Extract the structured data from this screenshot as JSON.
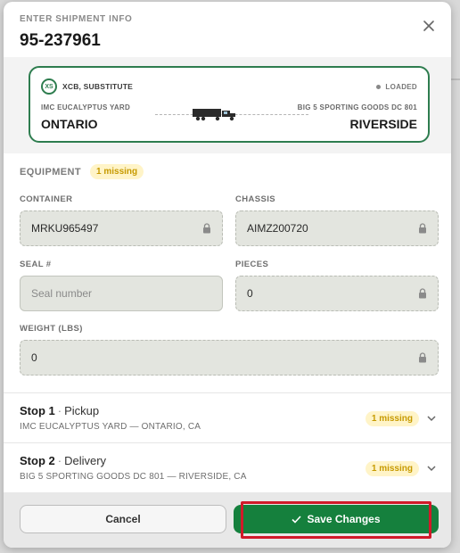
{
  "modal": {
    "eyebrow": "ENTER SHIPMENT INFO",
    "title": "95-237961"
  },
  "route": {
    "carrier_badge": "XS",
    "carrier_name": "XCB, SUBSTITUTE",
    "status": "LOADED",
    "origin": {
      "name": "IMC EUCALYPTUS YARD",
      "city": "ONTARIO"
    },
    "destination": {
      "name": "BIG 5 SPORTING GOODS DC 801",
      "city": "RIVERSIDE"
    }
  },
  "equipment": {
    "section_label": "EQUIPMENT",
    "missing_badge": "1 missing",
    "container": {
      "label": "CONTAINER",
      "value": "MRKU965497"
    },
    "chassis": {
      "label": "CHASSIS",
      "value": "AIMZ200720"
    },
    "seal": {
      "label": "SEAL #",
      "placeholder": "Seal number"
    },
    "pieces": {
      "label": "PIECES",
      "value": "0"
    },
    "weight": {
      "label": "WEIGHT (LBS)",
      "value": "0"
    }
  },
  "stops": [
    {
      "num": "Stop 1",
      "type": "Pickup",
      "address": "IMC EUCALYPTUS YARD — ONTARIO, CA",
      "missing": "1 missing"
    },
    {
      "num": "Stop 2",
      "type": "Delivery",
      "address": "BIG 5 SPORTING GOODS DC 801 — RIVERSIDE, CA",
      "missing": "1 missing"
    }
  ],
  "footer": {
    "cancel_label": "Cancel",
    "save_label": "Save Changes"
  },
  "colors": {
    "accent_green": "#15803d",
    "card_border": "#2e7d4f",
    "missing_bg": "#fff4c8",
    "missing_text": "#c79a00",
    "highlight": "#d11a2a"
  },
  "icons": {
    "close": "close-icon",
    "lock": "lock-icon",
    "truck": "truck-icon",
    "chevron": "chevron-down-icon",
    "check": "check-icon"
  }
}
